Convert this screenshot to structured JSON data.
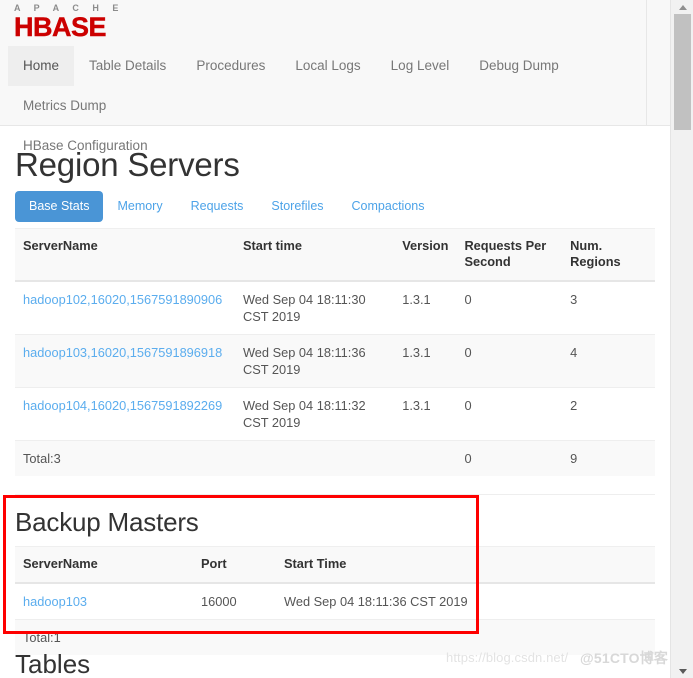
{
  "brand": {
    "apache": "A P A C H E",
    "hbase": "HBASE"
  },
  "nav": {
    "items": [
      {
        "label": "Home",
        "active": true
      },
      {
        "label": "Table Details",
        "active": false
      },
      {
        "label": "Procedures",
        "active": false
      },
      {
        "label": "Local Logs",
        "active": false
      },
      {
        "label": "Log Level",
        "active": false
      },
      {
        "label": "Debug Dump",
        "active": false
      },
      {
        "label": "Metrics Dump",
        "active": false
      },
      {
        "label": "HBase Configuration",
        "active": false
      }
    ]
  },
  "region_servers": {
    "heading": "Region Servers",
    "tabs": [
      {
        "label": "Base Stats",
        "active": true
      },
      {
        "label": "Memory",
        "active": false
      },
      {
        "label": "Requests",
        "active": false
      },
      {
        "label": "Storefiles",
        "active": false
      },
      {
        "label": "Compactions",
        "active": false
      }
    ],
    "columns": [
      "ServerName",
      "Start time",
      "Version",
      "Requests Per Second",
      "Num. Regions"
    ],
    "rows": [
      {
        "server_name": "hadoop102,16020,1567591890906",
        "start_time": "Wed Sep 04 18:11:30 CST 2019",
        "version": "1.3.1",
        "requests_per_second": "0",
        "num_regions": "3"
      },
      {
        "server_name": "hadoop103,16020,1567591896918",
        "start_time": "Wed Sep 04 18:11:36 CST 2019",
        "version": "1.3.1",
        "requests_per_second": "0",
        "num_regions": "4"
      },
      {
        "server_name": "hadoop104,16020,1567591892269",
        "start_time": "Wed Sep 04 18:11:32 CST 2019",
        "version": "1.3.1",
        "requests_per_second": "0",
        "num_regions": "2"
      }
    ],
    "total": {
      "label": "Total:3",
      "start_time": "",
      "version": "",
      "requests_per_second": "0",
      "num_regions": "9"
    }
  },
  "backup_masters": {
    "heading": "Backup Masters",
    "columns": [
      "ServerName",
      "Port",
      "Start Time"
    ],
    "rows": [
      {
        "server_name": "hadoop103",
        "port": "16000",
        "start_time": "Wed Sep 04 18:11:36 CST 2019"
      }
    ],
    "total": {
      "label": "Total:1",
      "port": "",
      "start_time": ""
    }
  },
  "tables_section": {
    "heading": "Tables"
  },
  "watermarks": {
    "csdn": "https://blog.csdn.net/",
    "cto": "@51CTO博客"
  },
  "colors": {
    "brand_red": "#cc0000",
    "accent_blue": "#4a95d6",
    "link_blue": "#5badee",
    "annotation_red": "#fe0000"
  }
}
